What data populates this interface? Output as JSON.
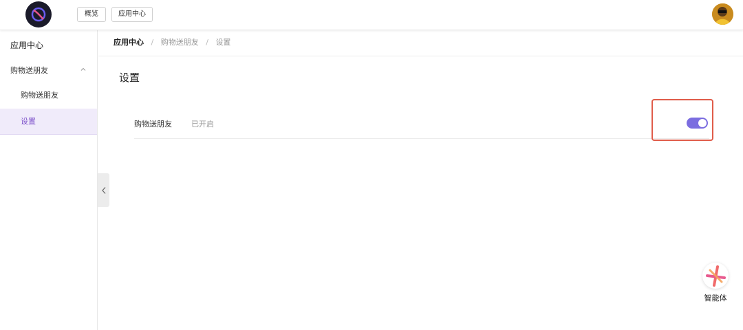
{
  "header": {
    "overview_label": "概览",
    "appcenter_label": "应用中心",
    "logo_icon": "app-logo-icon",
    "avatar_icon": "user-avatar"
  },
  "sidebar": {
    "title": "应用中心",
    "group": {
      "label": "购物送朋友",
      "icon": "chevron-up-icon"
    },
    "items": [
      {
        "label": "购物送朋友",
        "active": false
      },
      {
        "label": "设置",
        "active": true
      }
    ]
  },
  "breadcrumb": {
    "items": [
      "应用中心",
      "购物送朋友",
      "设置"
    ],
    "separator": "/"
  },
  "main": {
    "title": "设置",
    "setting": {
      "name": "购物送朋友",
      "status": "已开启",
      "enabled": true
    }
  },
  "agent": {
    "label": "智能体",
    "icon": "agent-star-icon"
  },
  "colors": {
    "accent": "#7b4fc9",
    "toggle_on": "#7b6de0",
    "highlight": "#e05c4a",
    "active_bg": "#f0ebfa"
  }
}
